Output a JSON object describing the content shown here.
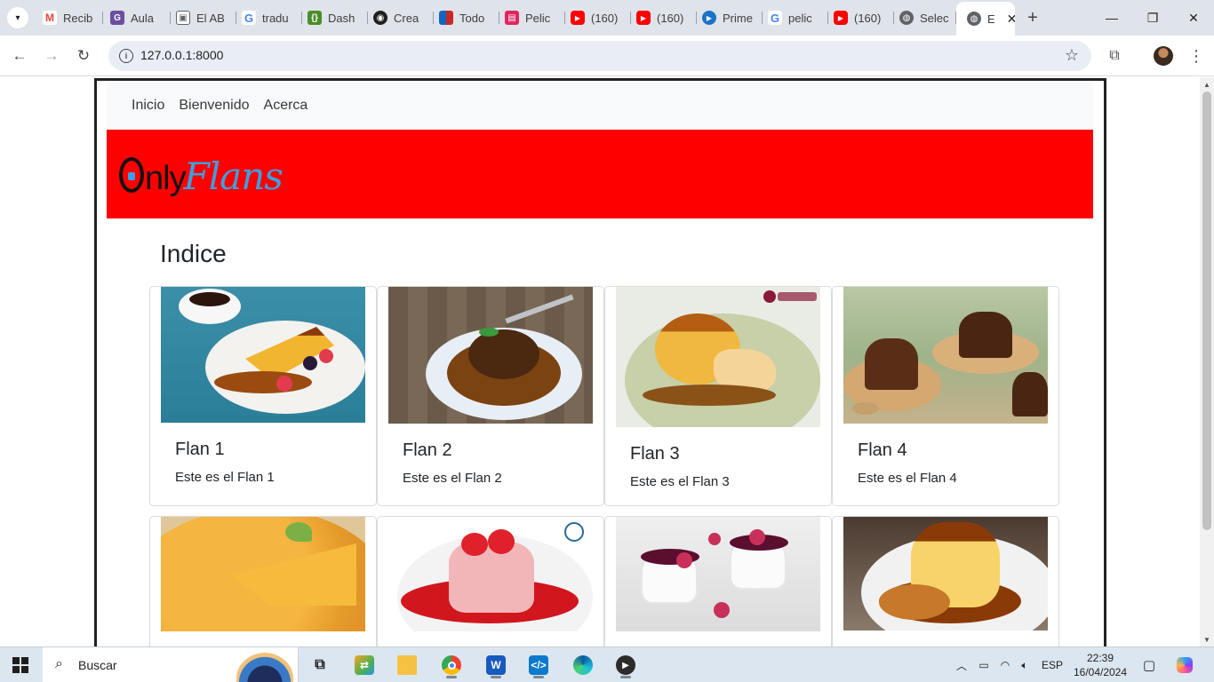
{
  "browser": {
    "tabs": [
      {
        "label": "Recib",
        "icon": "gmail-icon",
        "color": "#ea4335"
      },
      {
        "label": "Aula",
        "icon": "gs-icon",
        "color": "#6b4fa0"
      },
      {
        "label": "El AB",
        "icon": "chip-icon",
        "color": "#5f6368"
      },
      {
        "label": "tradu",
        "icon": "google-icon",
        "color": "#4285f4"
      },
      {
        "label": "Dash",
        "icon": "dashboard-icon",
        "color": "#4c8c2b"
      },
      {
        "label": "Crea",
        "icon": "github-icon",
        "color": "#1f1f1f"
      },
      {
        "label": "Todo",
        "icon": "todo-icon",
        "color": "#c62828"
      },
      {
        "label": "Pelic",
        "icon": "film-icon",
        "color": "#e0245e"
      },
      {
        "label": "(160)",
        "icon": "youtube-icon",
        "color": "#ff0000"
      },
      {
        "label": "(160)",
        "icon": "youtube-icon",
        "color": "#ff0000"
      },
      {
        "label": "Prime",
        "icon": "prime-icon",
        "color": "#1a73c8"
      },
      {
        "label": "pelic",
        "icon": "google-icon",
        "color": "#4285f4"
      },
      {
        "label": "(160)",
        "icon": "youtube-icon",
        "color": "#ff0000"
      },
      {
        "label": "Selec",
        "icon": "globe-icon",
        "color": "#5f6368"
      }
    ],
    "active_tab": {
      "label": "E",
      "icon": "globe-icon"
    },
    "url": "127.0.0.1:8000"
  },
  "site": {
    "nav": [
      "Inicio",
      "Bienvenido",
      "Acerca"
    ],
    "logo": {
      "part1": "nly",
      "part2": "Flans"
    },
    "heading": "Indice",
    "brand_color": "#ff0000",
    "cards": [
      {
        "title": "Flan 1",
        "text": "Este es el Flan 1"
      },
      {
        "title": "Flan 2",
        "text": "Este es el Flan 2"
      },
      {
        "title": "Flan 3",
        "text": "Este es el Flan 3"
      },
      {
        "title": "Flan 4",
        "text": "Este es el Flan 4"
      },
      {
        "title": "",
        "text": ""
      },
      {
        "title": "",
        "text": ""
      },
      {
        "title": "",
        "text": ""
      },
      {
        "title": "",
        "text": ""
      }
    ]
  },
  "taskbar": {
    "search_label": "Buscar",
    "language": "ESP",
    "time": "22:39",
    "date": "16/04/2024"
  }
}
